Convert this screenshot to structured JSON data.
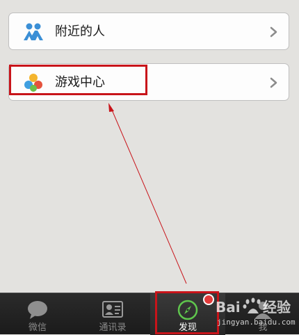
{
  "list": {
    "items": [
      {
        "label": "附近的人",
        "icon": "people-nearby-icon"
      },
      {
        "label": "游戏中心",
        "icon": "game-center-icon"
      }
    ]
  },
  "tabbar": {
    "tabs": [
      {
        "label": "微信",
        "icon": "chat-bubble-icon",
        "active": false
      },
      {
        "label": "通讯录",
        "icon": "contacts-icon",
        "active": false
      },
      {
        "label": "发现",
        "icon": "compass-icon",
        "active": true
      },
      {
        "label": "我",
        "icon": "person-icon",
        "active": false
      }
    ]
  },
  "watermark": {
    "url": "jingyan.baidu.com"
  },
  "colors": {
    "annotation_red": "#c8141a",
    "badge_red": "#e23a3a",
    "background": "#e3e2df"
  }
}
